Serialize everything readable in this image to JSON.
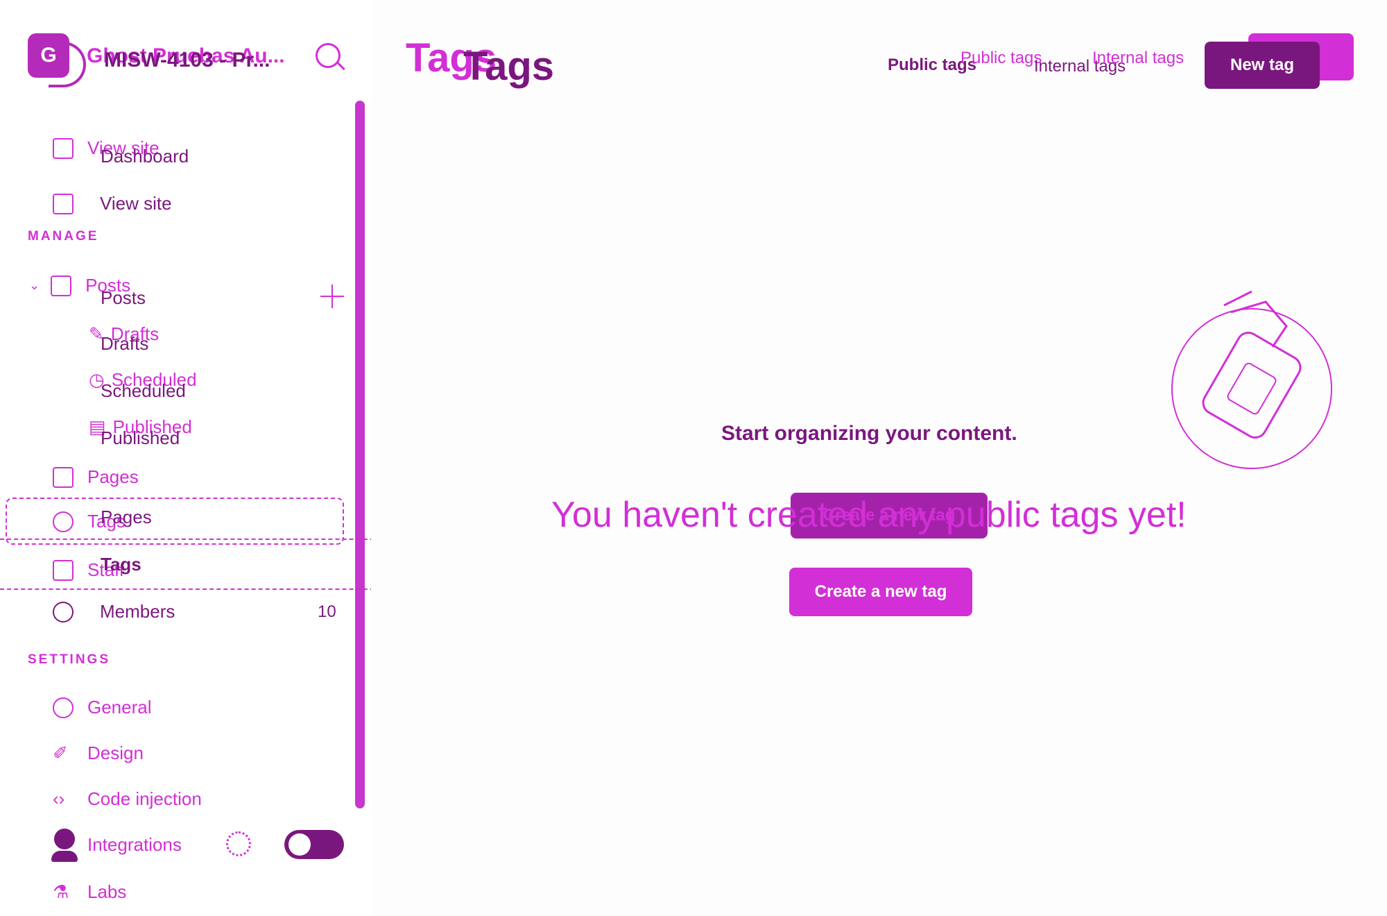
{
  "sidebar": {
    "site_logo_text": "G",
    "site_name_primary": "Ghost Pruebas Au...",
    "site_name_secondary": "MISW-4103 - Pr...",
    "nav_top": [
      {
        "label": "View site",
        "icon": "home-icon"
      },
      {
        "label": "Dashboard",
        "icon": "dashboard-icon"
      },
      {
        "label": "View site",
        "icon": "layout-icon"
      }
    ],
    "manage_title": "MANAGE",
    "posts_label": "Posts",
    "posts_label_ghost": "Posts",
    "posts_sub": [
      {
        "label": "Drafts",
        "ghost": "Drafts"
      },
      {
        "label": "Scheduled",
        "ghost": "Scheduled"
      },
      {
        "label": "Published",
        "ghost": "Published"
      }
    ],
    "pages_label": "Pages",
    "tags_label": "Tags",
    "pages_ghost": "Pages",
    "staff_label": "Staff",
    "tags_ghost": "Tags",
    "members_label": "Members",
    "members_count": "10",
    "settings_title": "SETTINGS",
    "settings_items": [
      {
        "label": "General",
        "icon": "gear-icon"
      },
      {
        "label": "Design",
        "icon": "brush-icon"
      },
      {
        "label": "Code injection",
        "icon": "code-icon"
      },
      {
        "label": "Integrations",
        "icon": "integrations-icon"
      },
      {
        "label": "Labs",
        "icon": "flask-icon"
      }
    ]
  },
  "header": {
    "title": "Tags",
    "title_ghost": "Tags",
    "tab_public": "Public tags",
    "tab_internal": "Internal tags",
    "tab_public_ghost": "Public tags",
    "tab_internal_ghost": "Internal tags",
    "new_tag": "New tag"
  },
  "empty_state": {
    "heading": "Start organizing your content.",
    "message": "You haven't created any public tags yet!",
    "create_button": "Create a new tag",
    "create_button_ghost": "Create a new tag"
  },
  "colors": {
    "accent": "#d22fd6",
    "accent_dark": "#7a177e"
  }
}
